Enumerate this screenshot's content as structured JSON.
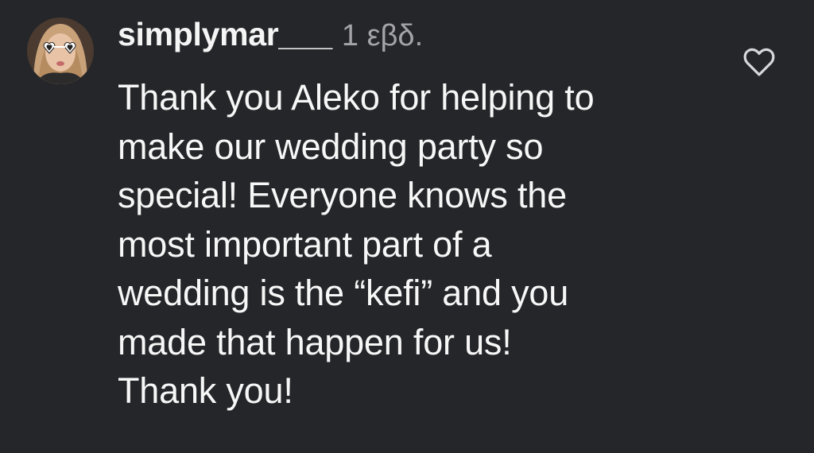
{
  "comment": {
    "username": "simplymar___",
    "time": "1 εβδ.",
    "lines": [
      "Thank you Aleko for helping to",
      "make our wedding party so",
      "special! Everyone knows the",
      "most important part of a",
      "wedding is the “kefi” and you",
      "made that happen for us!",
      "Thank you!"
    ],
    "like_icon": "heart-outline-icon",
    "avatar_icon": "profile-photo"
  },
  "colors": {
    "background": "#25262a",
    "text": "#f5f5f5",
    "secondary_text": "#a3a3a8"
  }
}
